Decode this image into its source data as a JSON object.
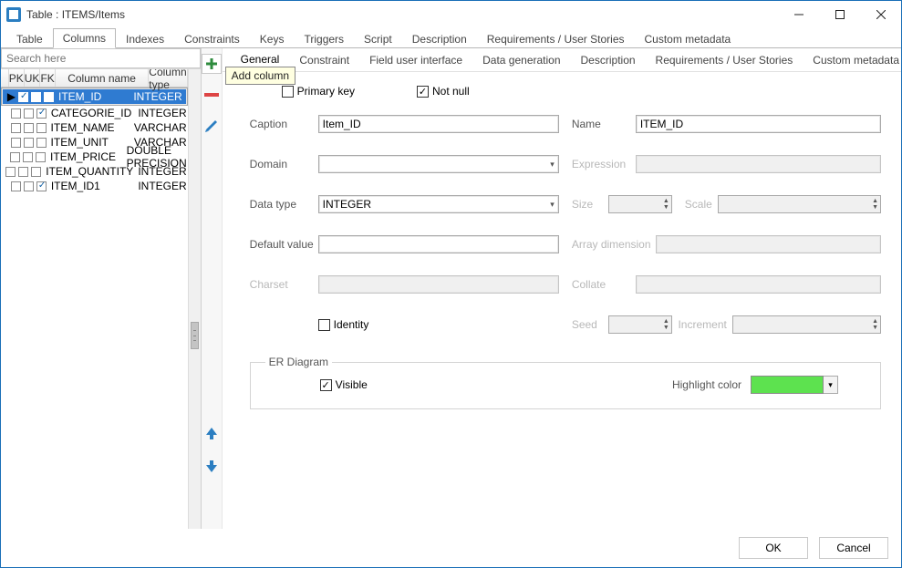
{
  "window": {
    "title": "Table : ITEMS/Items",
    "tooltip_add_column": "Add column"
  },
  "main_tabs": [
    "Table",
    "Columns",
    "Indexes",
    "Constraints",
    "Keys",
    "Triggers",
    "Script",
    "Description",
    "Requirements / User Stories",
    "Custom metadata"
  ],
  "main_tabs_active": 1,
  "search_placeholder": "Search here",
  "grid_headers": {
    "pk": "PK",
    "uk": "UK",
    "fk": "FK",
    "name": "Column name",
    "type": "Column type"
  },
  "columns": [
    {
      "mark": "▶",
      "pk": true,
      "uk": false,
      "fk": false,
      "name": "ITEM_ID",
      "type": "INTEGER",
      "selected": true
    },
    {
      "mark": "",
      "pk": false,
      "uk": false,
      "fk": true,
      "name": "CATEGORIE_ID",
      "type": "INTEGER"
    },
    {
      "mark": "",
      "pk": false,
      "uk": false,
      "fk": false,
      "name": "ITEM_NAME",
      "type": "VARCHAR"
    },
    {
      "mark": "",
      "pk": false,
      "uk": false,
      "fk": false,
      "name": "ITEM_UNIT",
      "type": "VARCHAR"
    },
    {
      "mark": "",
      "pk": false,
      "uk": false,
      "fk": false,
      "name": "ITEM_PRICE",
      "type": "DOUBLE PRECISION"
    },
    {
      "mark": "",
      "pk": false,
      "uk": false,
      "fk": false,
      "name": "ITEM_QUANTITY",
      "type": "INTEGER"
    },
    {
      "mark": "",
      "pk": false,
      "uk": false,
      "fk": true,
      "name": "ITEM_ID1",
      "type": "INTEGER"
    }
  ],
  "right_tabs": [
    "General",
    "Constraint",
    "Field user interface",
    "Data generation",
    "Description",
    "Requirements / User Stories",
    "Custom metadata"
  ],
  "right_tabs_active": 0,
  "form": {
    "primary_key_label": "Primary key",
    "primary_key_checked": false,
    "not_null_label": "Not null",
    "not_null_checked": true,
    "caption_label": "Caption",
    "caption_value": "Item_ID",
    "name_label": "Name",
    "name_value": "ITEM_ID",
    "domain_label": "Domain",
    "domain_value": "",
    "expression_label": "Expression",
    "expression_value": "",
    "datatype_label": "Data type",
    "datatype_value": "INTEGER",
    "size_label": "Size",
    "scale_label": "Scale",
    "default_label": "Default value",
    "default_value": "",
    "array_label": "Array dimension",
    "charset_label": "Charset",
    "charset_value": "",
    "collate_label": "Collate",
    "collate_value": "",
    "identity_label": "Identity",
    "identity_checked": false,
    "seed_label": "Seed",
    "increment_label": "Increment",
    "er_legend": "ER Diagram",
    "visible_label": "Visible",
    "visible_checked": true,
    "highlight_label": "Highlight color"
  },
  "footer": {
    "ok": "OK",
    "cancel": "Cancel"
  }
}
